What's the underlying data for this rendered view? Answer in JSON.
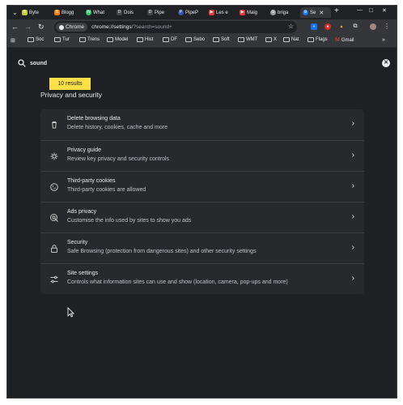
{
  "tabs": [
    {
      "label": "Byte",
      "color": "#c0ca33",
      "glyph": "B"
    },
    {
      "label": "Blogg",
      "color": "#f57c00",
      "glyph": "B"
    },
    {
      "label": "What",
      "color": "#25d366",
      "glyph": "W"
    },
    {
      "label": "Dois",
      "color": "#444444",
      "glyph": "D"
    },
    {
      "label": "Pipe",
      "color": "#444444",
      "glyph": "D"
    },
    {
      "label": "PipeP",
      "color": "#3f51b5",
      "glyph": "P"
    },
    {
      "label": "Les e",
      "color": "#e53935",
      "glyph": "▶"
    },
    {
      "label": "Maig",
      "color": "#e53935",
      "glyph": "▶"
    },
    {
      "label": "briga",
      "color": "#9e9e9e",
      "glyph": "G"
    },
    {
      "label": "Se",
      "color": "#1a73e8",
      "glyph": "⚙",
      "active": true
    }
  ],
  "toolbar": {
    "chip_label": "Chrome",
    "url_host": "chrome://settings",
    "url_rest": "/?search=sound+"
  },
  "bookmarks": [
    "Soc",
    "Tur",
    "Trens",
    "Model",
    "Hist",
    "DF",
    "Sebo",
    "Soft",
    "WMT",
    "X",
    "Nat",
    "Flags",
    "Gmail"
  ],
  "search": {
    "query": "sound"
  },
  "results_badge": "10 results",
  "section_title": "Privacy and security",
  "rows": [
    {
      "title": "Delete browsing data",
      "subtitle": "Delete history, cookies, cache and more",
      "icon": "trash-icon"
    },
    {
      "title": "Privacy guide",
      "subtitle": "Review key privacy and security controls",
      "icon": "privacy-guide-icon"
    },
    {
      "title": "Third-party cookies",
      "subtitle": "Third-party cookies are allowed",
      "icon": "cookie-icon"
    },
    {
      "title": "Ads privacy",
      "subtitle": "Customise the info used by sites to show you ads",
      "icon": "ads-privacy-icon"
    },
    {
      "title": "Security",
      "subtitle": "Safe Browsing (protection from dangerous sites) and other security settings",
      "icon": "lock-icon"
    },
    {
      "title": "Site settings",
      "subtitle": "Controls what information sites can use and show (location, camera, pop-ups and more)",
      "icon": "sliders-icon"
    }
  ]
}
